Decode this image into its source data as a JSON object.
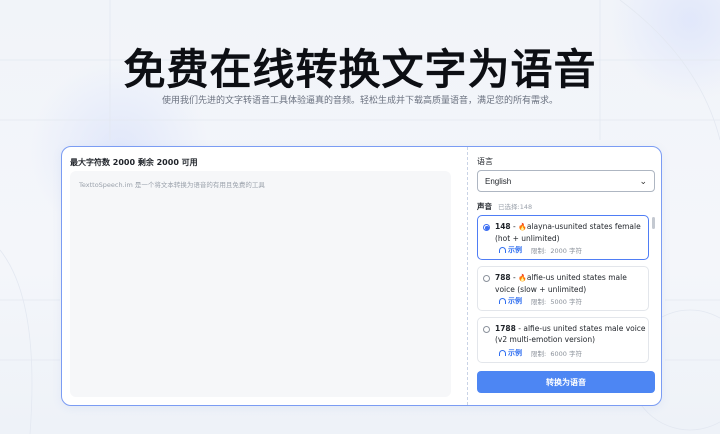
{
  "hero": {
    "title": "免费在线转换文字为语音",
    "subtitle": "使用我们先进的文字转语音工具体验逼真的音频。轻松生成并下载高质量语音，满足您的所有需求。"
  },
  "editor": {
    "limit_label": "最大字符数 2000 剩余 2000 可用",
    "placeholder": "TexttoSpeech.im 是一个将文本转换为语音的有用且免费的工具"
  },
  "language": {
    "label": "语言",
    "selected": "English"
  },
  "voices": {
    "label": "声音",
    "selected_count": "已选择:148",
    "items": [
      {
        "id": "148",
        "name": "alayna-usunited states female (hot + unlimited)",
        "hot": true,
        "sample": "示例",
        "limit": "限制:",
        "limit_value": "2000 字符",
        "selected": true
      },
      {
        "id": "788",
        "name": "alfie-us united states male voice (slow + unlimited)",
        "hot": true,
        "sample": "示例",
        "limit": "限制:",
        "limit_value": "5000 字符",
        "selected": false
      },
      {
        "id": "1788",
        "name": "alfie-us united states male voice (v2 multi-emotion version)",
        "hot": false,
        "sample": "示例",
        "limit": "限制:",
        "limit_value": "6000 字符",
        "selected": false
      }
    ]
  },
  "actions": {
    "convert_label": "转换为语音"
  },
  "colors": {
    "accent": "#4d86f3",
    "card_border": "#7b9cf3",
    "flame": "#f39324"
  },
  "icons": {
    "flame": "flame-icon",
    "sample": "headphone-icon",
    "select": "chevron-down-icon"
  }
}
